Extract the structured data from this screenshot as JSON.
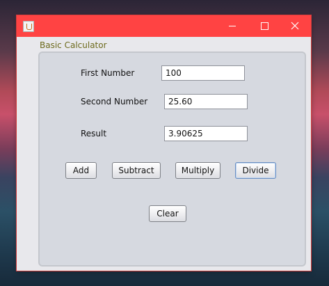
{
  "window": {
    "controls": {
      "minimize": "minimize",
      "maximize": "maximize",
      "close": "close"
    }
  },
  "group": {
    "title": "Basic Calculator"
  },
  "fields": {
    "first": {
      "label": "First Number",
      "value": "100"
    },
    "second": {
      "label": "Second Number",
      "value": "25.60"
    },
    "result": {
      "label": "Result",
      "value": "3.90625"
    }
  },
  "buttons": {
    "add": "Add",
    "subtract": "Subtract",
    "multiply": "Multiply",
    "divide": "Divide",
    "clear": "Clear"
  },
  "colors": {
    "titlebar": "#ff4343",
    "group_title": "#6d6a1c",
    "panel": "#d6d9e0"
  },
  "icons": {
    "app": "java-cup-icon",
    "minimize": "minimize-icon",
    "maximize": "maximize-icon",
    "close": "close-icon"
  }
}
